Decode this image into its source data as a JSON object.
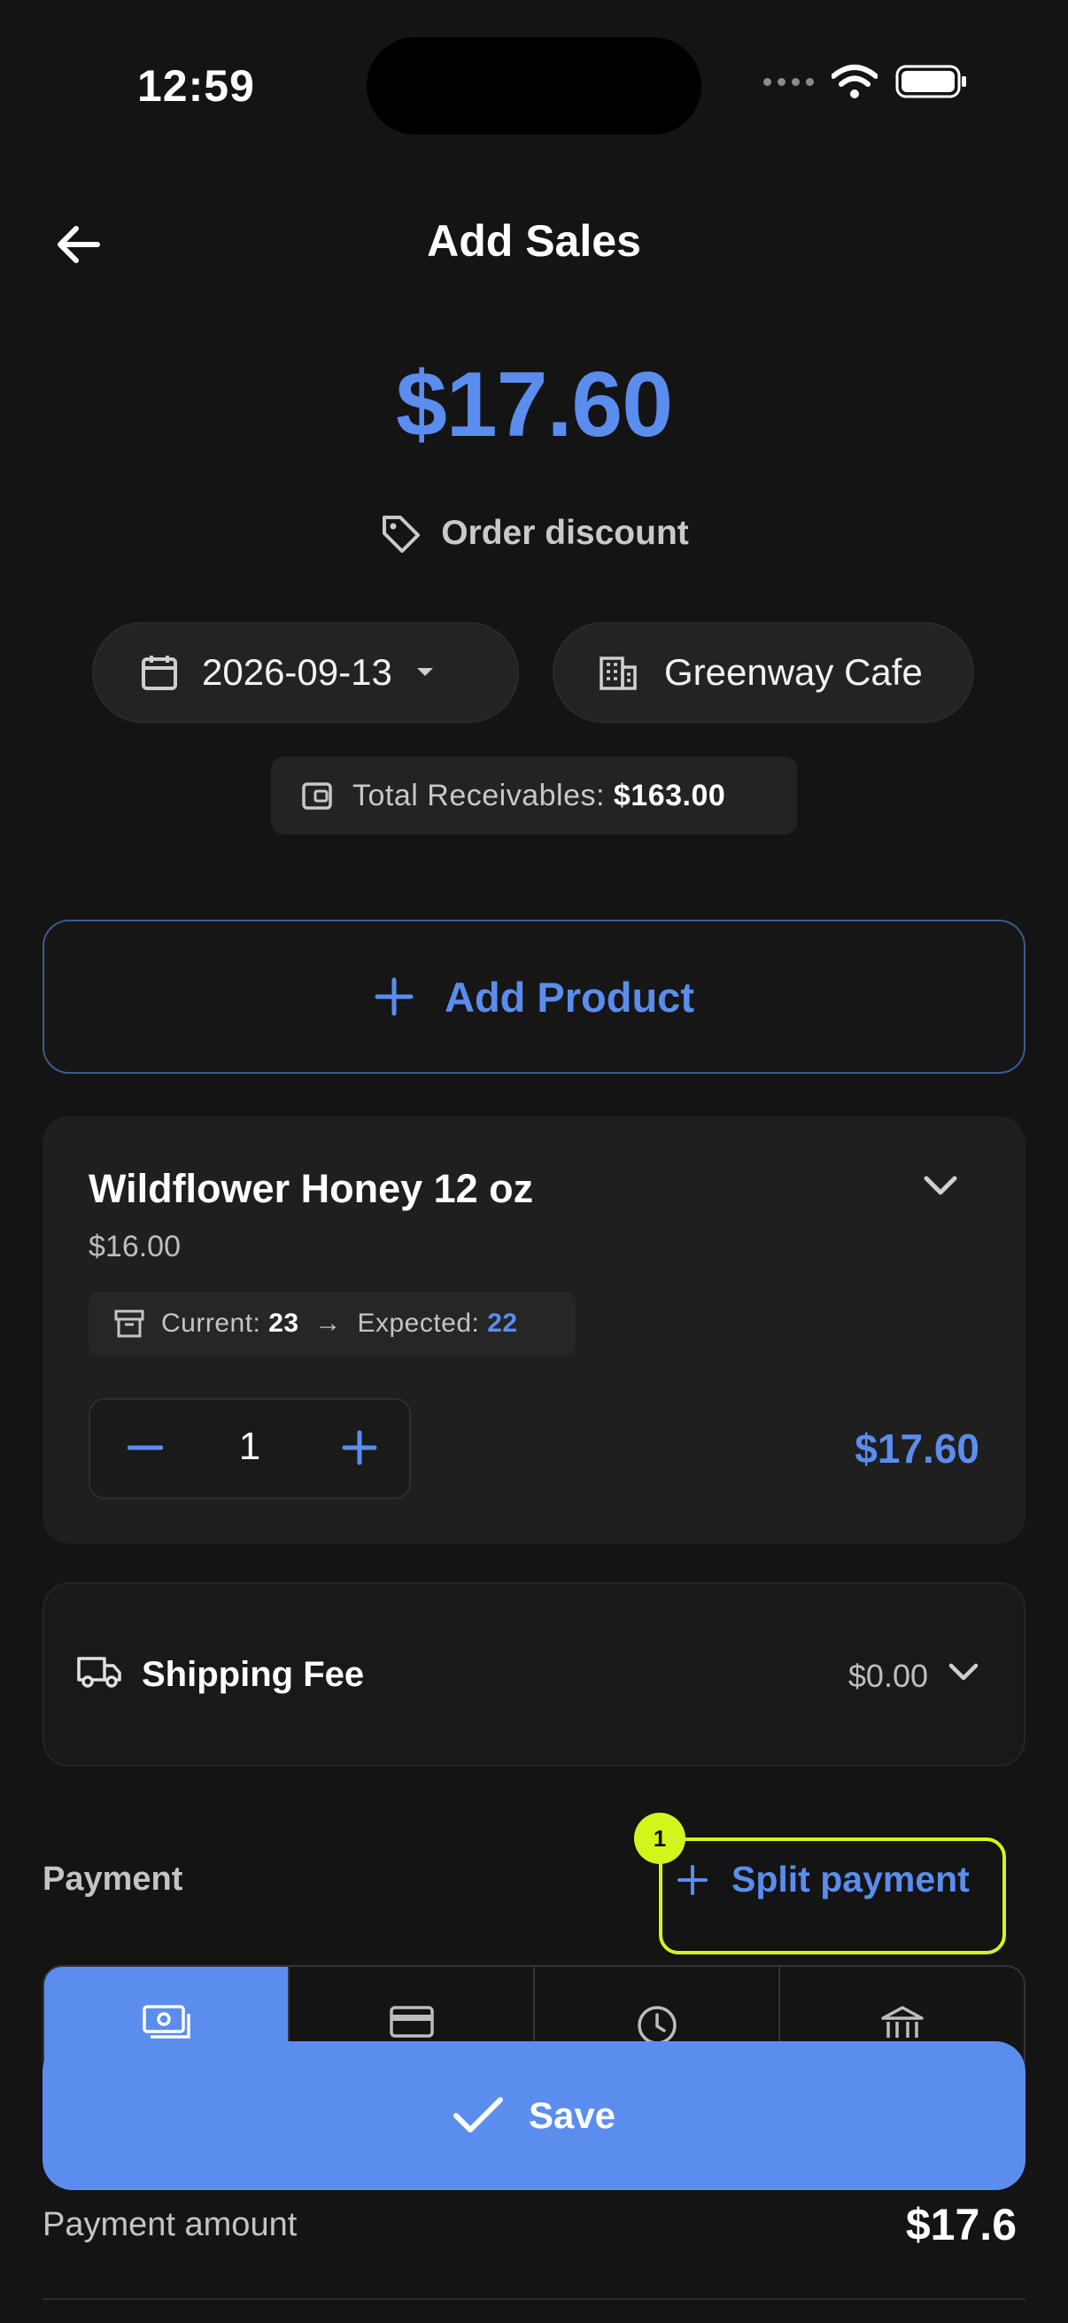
{
  "status_bar": {
    "time": "12:59"
  },
  "header": {
    "title": "Add Sales"
  },
  "summary": {
    "total": "$17.60",
    "discount_label": "Order discount"
  },
  "filters": {
    "date": "2026-09-13",
    "store": "Greenway Cafe"
  },
  "receivables": {
    "label": "Total Receivables:",
    "value": "$163.00"
  },
  "add_product": {
    "label": "Add Product"
  },
  "product": {
    "name": "Wildflower Honey 12 oz",
    "price": "$16.00",
    "current_label": "Current:",
    "current_value": "23",
    "arrow": "→",
    "expected_label": "Expected:",
    "expected_value": "22",
    "quantity": "1",
    "line_total": "$17.60"
  },
  "shipping": {
    "label": "Shipping Fee",
    "value": "$0.00"
  },
  "payment": {
    "section_label": "Payment",
    "split_label": "Split payment",
    "annotation_number": "1",
    "tabs": [
      {
        "icon": "cash-icon",
        "active": true
      },
      {
        "icon": "credit-card-icon",
        "active": false
      },
      {
        "icon": "clock-icon",
        "active": false
      },
      {
        "icon": "bank-icon",
        "active": false
      }
    ],
    "amount_label": "Payment amount",
    "amount_value": "$17.6"
  },
  "save": {
    "label": "Save"
  },
  "colors": {
    "accent": "#5b8def",
    "highlight": "#d4f51c",
    "background": "#141414",
    "card": "#1f1f1f"
  }
}
